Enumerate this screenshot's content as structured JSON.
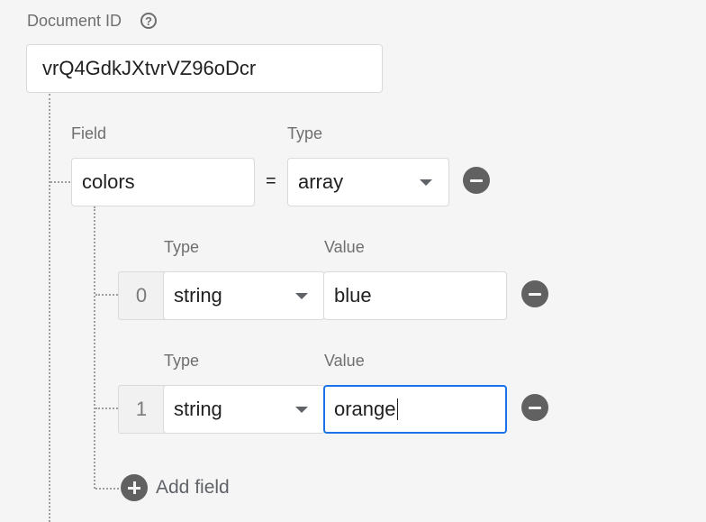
{
  "document_id": {
    "label": "Document ID",
    "value": "vrQ4GdkJXtvrVZ96oDcr"
  },
  "field": {
    "field_label": "Field",
    "type_label": "Type",
    "name": "colors",
    "equals": "=",
    "type": "array"
  },
  "array_items": [
    {
      "index": "0",
      "type_label": "Type",
      "value_label": "Value",
      "type": "string",
      "value": "blue"
    },
    {
      "index": "1",
      "type_label": "Type",
      "value_label": "Value",
      "type": "string",
      "value": "orange"
    }
  ],
  "add_field": {
    "label": "Add field"
  },
  "colors": {
    "focus_border": "#1a73e8",
    "icon_bg": "#616161",
    "background": "#f5f5f5"
  }
}
